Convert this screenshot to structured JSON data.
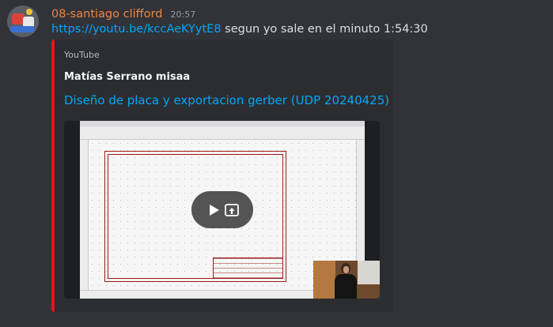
{
  "message": {
    "username": "08-santiago clifford",
    "timestamp": "20:57",
    "link": "https://youtu.be/kccAeKYytE8",
    "text": " segun yo sale en el minuto 1:54:30"
  },
  "embed": {
    "accent_color": "#e0161c",
    "provider": "YouTube",
    "author": "Matías Serrano misaa",
    "title": "Diseño de placa y exportacion gerber (UDP 20240425)"
  },
  "video": {
    "play_icon": "play-icon",
    "open_icon": "open-external-icon"
  },
  "colors": {
    "username": "#f0863c",
    "link": "#00a8fc",
    "background": "#313338",
    "embed_background": "#2b2d31"
  }
}
